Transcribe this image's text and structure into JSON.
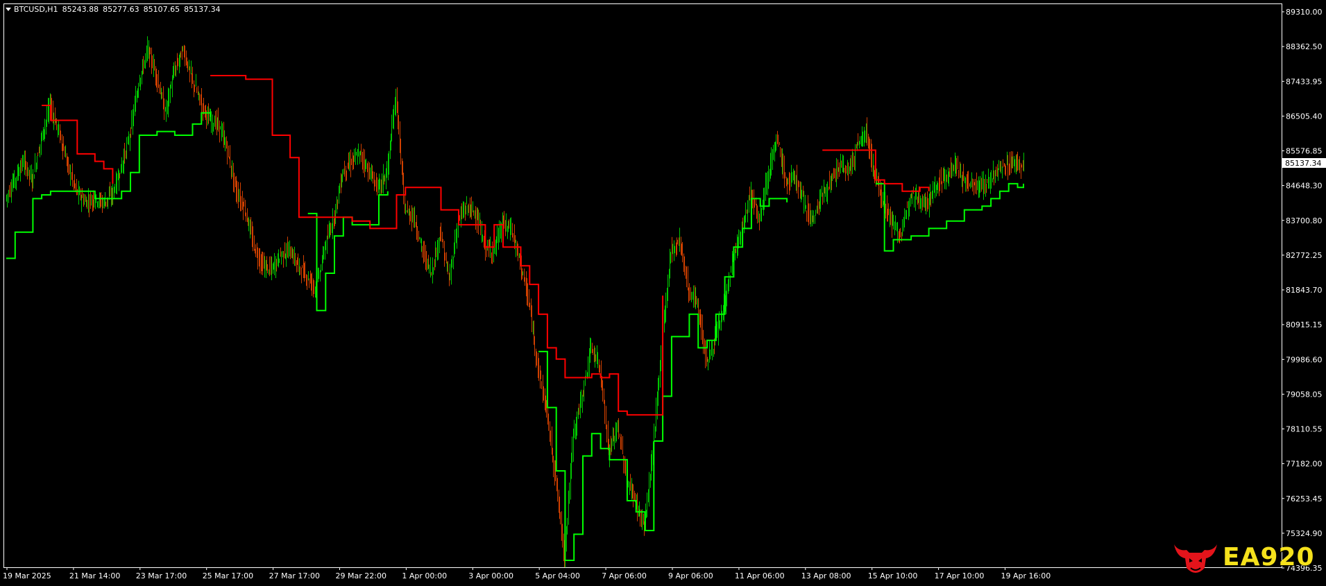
{
  "header": {
    "symbol": "BTCUSD,H1",
    "open": "85243.88",
    "high": "85277.63",
    "low": "85107.65",
    "close": "85137.34"
  },
  "price_axis": {
    "labels": [
      "89310.00",
      "88362.50",
      "87433.95",
      "86505.40",
      "85576.85",
      "84648.30",
      "83700.80",
      "82772.25",
      "81843.70",
      "80915.15",
      "79986.60",
      "79058.05",
      "78110.55",
      "77182.00",
      "76253.45",
      "75324.90",
      "74396.35"
    ],
    "current_price": "85137.34"
  },
  "time_axis": {
    "labels": [
      "19 Mar 2025",
      "21 Mar 14:00",
      "23 Mar 17:00",
      "25 Mar 17:00",
      "27 Mar 17:00",
      "29 Mar 22:00",
      "1 Apr 00:00",
      "3 Apr 00:00",
      "5 Apr 04:00",
      "7 Apr 06:00",
      "9 Apr 06:00",
      "11 Apr 06:00",
      "13 Apr 08:00",
      "15 Apr 10:00",
      "17 Apr 10:00",
      "19 Apr 16:00"
    ]
  },
  "colors": {
    "background": "#000000",
    "bull": "#00c800",
    "bear": "#d04000",
    "stop_up": "#00ff00",
    "stop_down": "#ff0000",
    "axis": "#ffffff"
  },
  "logo": {
    "text": "EA920",
    "icon": "bull-head-icon"
  },
  "chart_data": {
    "type": "candlestick",
    "ylim": [
      74396.35,
      89310.0
    ],
    "price_series": [
      [
        0,
        84300
      ],
      [
        3,
        84800
      ],
      [
        6,
        85300
      ],
      [
        9,
        84800
      ],
      [
        12,
        85900
      ],
      [
        15,
        86800
      ],
      [
        18,
        86100
      ],
      [
        21,
        85200
      ],
      [
        24,
        84500
      ],
      [
        27,
        84200
      ],
      [
        30,
        84300
      ],
      [
        33,
        84200
      ],
      [
        36,
        84400
      ],
      [
        39,
        85100
      ],
      [
        42,
        86000
      ],
      [
        45,
        87400
      ],
      [
        48,
        88300
      ],
      [
        51,
        87600
      ],
      [
        54,
        86600
      ],
      [
        57,
        87700
      ],
      [
        60,
        88300
      ],
      [
        63,
        87500
      ],
      [
        66,
        86900
      ],
      [
        69,
        86400
      ],
      [
        72,
        86300
      ],
      [
        75,
        85600
      ],
      [
        78,
        84500
      ],
      [
        81,
        84000
      ],
      [
        84,
        83000
      ],
      [
        87,
        82500
      ],
      [
        90,
        82400
      ],
      [
        93,
        82800
      ],
      [
        96,
        82900
      ],
      [
        99,
        82500
      ],
      [
        102,
        82200
      ],
      [
        105,
        81900
      ],
      [
        108,
        83000
      ],
      [
        111,
        83800
      ],
      [
        114,
        85000
      ],
      [
        117,
        85300
      ],
      [
        120,
        85500
      ],
      [
        123,
        85000
      ],
      [
        126,
        84600
      ],
      [
        129,
        85000
      ],
      [
        132,
        87100
      ],
      [
        135,
        84000
      ],
      [
        138,
        83800
      ],
      [
        141,
        82900
      ],
      [
        144,
        82300
      ],
      [
        147,
        83400
      ],
      [
        150,
        82100
      ],
      [
        153,
        83700
      ],
      [
        156,
        84100
      ],
      [
        159,
        83900
      ],
      [
        162,
        83000
      ],
      [
        165,
        82900
      ],
      [
        168,
        83600
      ],
      [
        171,
        83500
      ],
      [
        174,
        82600
      ],
      [
        177,
        81500
      ],
      [
        180,
        79800
      ],
      [
        183,
        78600
      ],
      [
        186,
        76800
      ],
      [
        189,
        74700
      ],
      [
        192,
        78000
      ],
      [
        195,
        79000
      ],
      [
        198,
        80300
      ],
      [
        201,
        79800
      ],
      [
        204,
        77500
      ],
      [
        207,
        78200
      ],
      [
        210,
        76800
      ],
      [
        213,
        76200
      ],
      [
        216,
        75500
      ],
      [
        219,
        77600
      ],
      [
        222,
        80500
      ],
      [
        225,
        82900
      ],
      [
        228,
        83200
      ],
      [
        231,
        81800
      ],
      [
        234,
        81500
      ],
      [
        237,
        79900
      ],
      [
        240,
        80500
      ],
      [
        243,
        81400
      ],
      [
        246,
        82700
      ],
      [
        249,
        83400
      ],
      [
        252,
        84500
      ],
      [
        255,
        83800
      ],
      [
        258,
        85000
      ],
      [
        261,
        85900
      ],
      [
        264,
        84700
      ],
      [
        267,
        84900
      ],
      [
        270,
        84200
      ],
      [
        273,
        83700
      ],
      [
        276,
        84400
      ],
      [
        279,
        84700
      ],
      [
        282,
        85200
      ],
      [
        285,
        85000
      ],
      [
        288,
        85700
      ],
      [
        291,
        86100
      ],
      [
        294,
        84900
      ],
      [
        297,
        84200
      ],
      [
        300,
        83600
      ],
      [
        303,
        83300
      ],
      [
        306,
        84500
      ],
      [
        309,
        84300
      ],
      [
        312,
        84200
      ],
      [
        315,
        84700
      ],
      [
        318,
        84900
      ],
      [
        321,
        85200
      ],
      [
        324,
        84800
      ],
      [
        327,
        84700
      ],
      [
        330,
        84600
      ],
      [
        333,
        84800
      ],
      [
        336,
        85100
      ],
      [
        339,
        85200
      ],
      [
        342,
        85300
      ],
      [
        344,
        85137
      ]
    ],
    "stop_up": [
      [
        0,
        82700
      ],
      [
        3,
        83400
      ],
      [
        9,
        84300
      ],
      [
        12,
        84400
      ],
      [
        15,
        84500
      ],
      [
        30,
        84300
      ],
      [
        39,
        84500
      ],
      [
        42,
        85000
      ],
      [
        45,
        86000
      ],
      [
        51,
        86100
      ],
      [
        57,
        86000
      ],
      [
        63,
        86300
      ],
      [
        66,
        86600
      ],
      [
        69,
        86500
      ]
    ],
    "stop_down": [
      [
        69,
        87600
      ],
      [
        81,
        87500
      ],
      [
        90,
        86000
      ],
      [
        96,
        85400
      ],
      [
        99,
        83800
      ],
      [
        117,
        83700
      ],
      [
        123,
        83500
      ],
      [
        132,
        84400
      ],
      [
        135,
        84600
      ],
      [
        141,
        84600
      ],
      [
        147,
        84000
      ],
      [
        150,
        84000
      ],
      [
        153,
        83600
      ],
      [
        159,
        83600
      ],
      [
        162,
        83000
      ],
      [
        165,
        83600
      ],
      [
        168,
        83000
      ],
      [
        171,
        83000
      ],
      [
        174,
        82500
      ],
      [
        177,
        82000
      ],
      [
        180,
        81200
      ],
      [
        183,
        80300
      ],
      [
        186,
        80000
      ],
      [
        189,
        79500
      ],
      [
        195,
        79500
      ],
      [
        198,
        79600
      ],
      [
        201,
        79500
      ],
      [
        204,
        79600
      ],
      [
        207,
        78600
      ],
      [
        210,
        78500
      ],
      [
        219,
        78500
      ]
    ]
  }
}
